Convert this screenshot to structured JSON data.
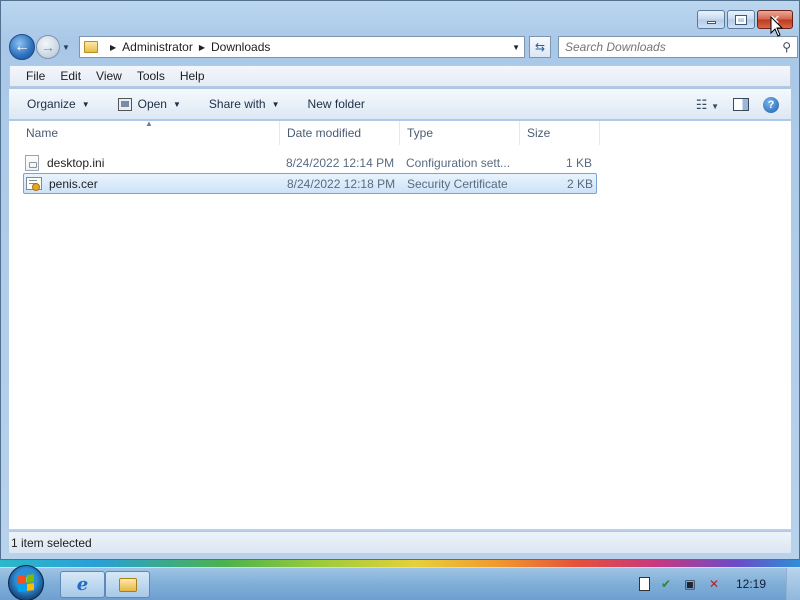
{
  "window": {
    "close_glyph": "✕"
  },
  "address_bar": {
    "crumbs": [
      "Administrator",
      "Downloads"
    ]
  },
  "search": {
    "placeholder": "Search Downloads"
  },
  "menubar": {
    "items": [
      "File",
      "Edit",
      "View",
      "Tools",
      "Help"
    ]
  },
  "commandbar": {
    "organize": "Organize",
    "open": "Open",
    "share_with": "Share with",
    "new_folder": "New folder"
  },
  "columns": {
    "name": "Name",
    "date": "Date modified",
    "type": "Type",
    "size": "Size"
  },
  "files": [
    {
      "name": "desktop.ini",
      "date": "8/24/2022 12:14 PM",
      "type": "Configuration sett...",
      "size": "1 KB",
      "icon": "ini-file-icon",
      "selected": false
    },
    {
      "name": "penis.cer",
      "date": "8/24/2022 12:18 PM",
      "type": "Security Certificate",
      "size": "2 KB",
      "icon": "certificate-icon",
      "selected": true
    }
  ],
  "status": {
    "text": "1 item selected"
  },
  "taskbar": {
    "clock": "12:19"
  }
}
